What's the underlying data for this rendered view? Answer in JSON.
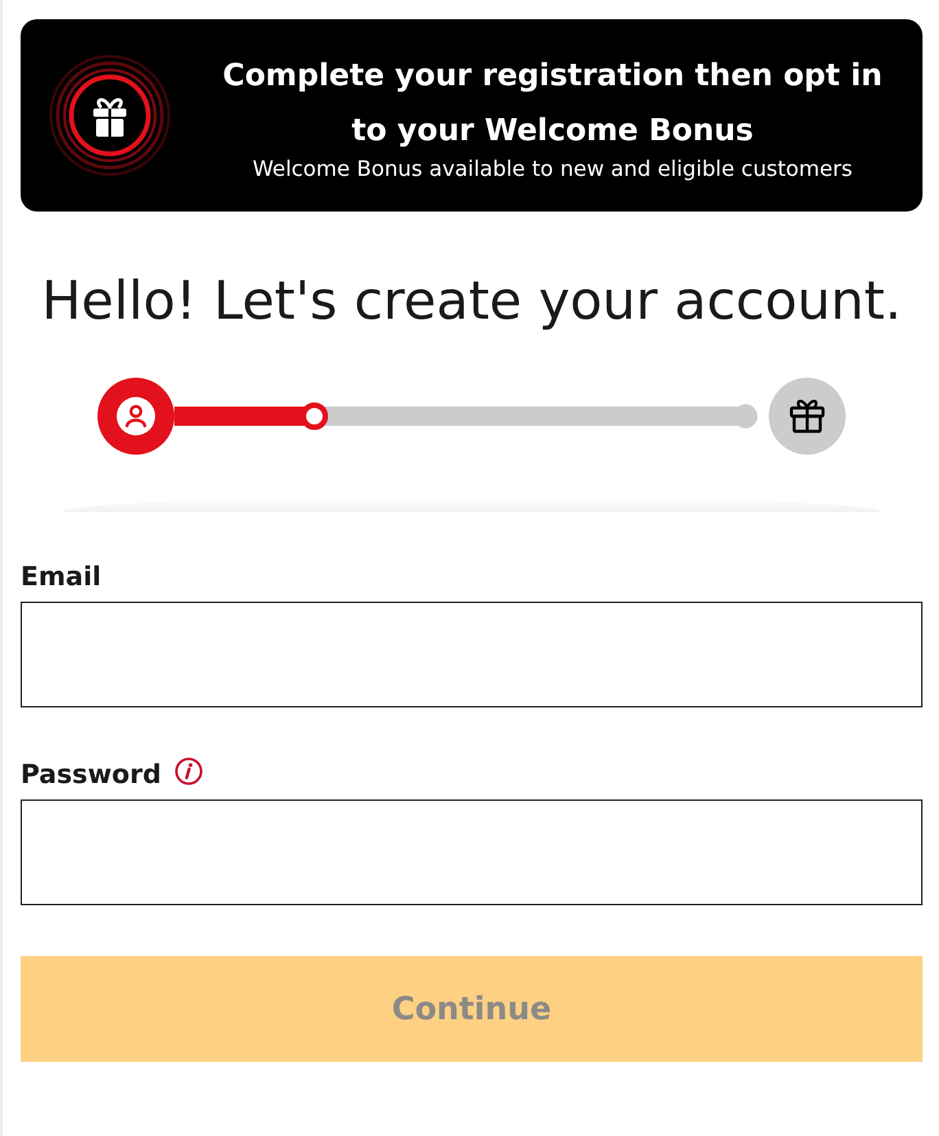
{
  "banner": {
    "title": "Complete your registration then opt in to your Welcome Bonus",
    "subtitle": "Welcome Bonus available to new and eligible customers"
  },
  "heading": "Hello! Let's create your account.",
  "progress": {
    "level": 0.24,
    "goal_reached": false
  },
  "fields": [
    {
      "label": "Email",
      "info": false
    },
    {
      "label": "Password",
      "info": true
    }
  ],
  "button": {
    "label": "Continue",
    "disabled": true
  }
}
